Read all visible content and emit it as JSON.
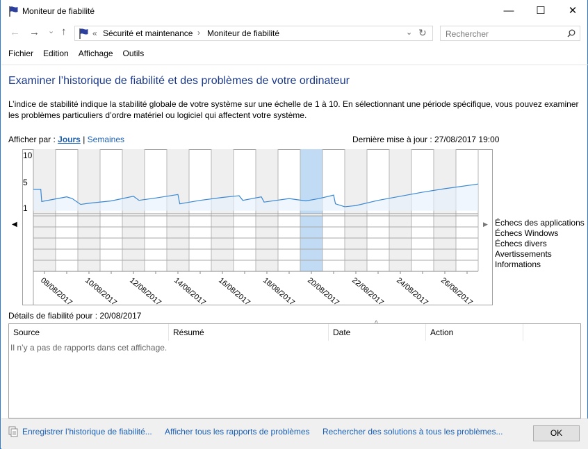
{
  "window": {
    "title": "Moniteur de fiabilité",
    "minimize": "—",
    "maximize": "☐",
    "close": "✕"
  },
  "nav": {
    "back": "←",
    "forward": "→",
    "recent": "⌄",
    "up": "↑",
    "breadcrumb_prefix": "«",
    "breadcrumb": [
      "Sécurité et maintenance",
      "Moniteur de fiabilité"
    ],
    "separator": "›",
    "refresh": "↻",
    "dropdown": "⌄",
    "search_placeholder": "Rechercher"
  },
  "menu": [
    "Fichier",
    "Edition",
    "Affichage",
    "Outils"
  ],
  "main": {
    "heading": "Examiner l’historique de fiabilité et des problèmes de votre ordinateur",
    "description": "L’indice de stabilité indique la stabilité globale de votre système sur une échelle de 1 à 10. En sélectionnant une période spécifique, vous pouvez examiner les problèmes particuliers d’ordre matériel ou logiciel qui affectent votre système.",
    "view_by_label": "Afficher par :",
    "view_days": "Jours",
    "view_sep": "|",
    "view_weeks": "Semaines",
    "last_update": "Dernière mise à jour : 27/08/2017 19:00",
    "details_label": "Détails de fiabilité pour : 20/08/2017",
    "table": {
      "columns": [
        "Source",
        "Résumé",
        "Date",
        "Action"
      ],
      "sorted_column": "Date",
      "empty_message": "Il n’y a pas de rapports dans cet affichage."
    }
  },
  "chart_data": {
    "type": "line",
    "y_ticks": [
      "10",
      "5",
      "1"
    ],
    "ylim": [
      0,
      10
    ],
    "dates": [
      "08/08/2017",
      "09/08/2017",
      "10/08/2017",
      "11/08/2017",
      "12/08/2017",
      "13/08/2017",
      "14/08/2017",
      "15/08/2017",
      "16/08/2017",
      "17/08/2017",
      "18/08/2017",
      "19/08/2017",
      "20/08/2017",
      "21/08/2017",
      "22/08/2017",
      "23/08/2017",
      "24/08/2017",
      "25/08/2017",
      "26/08/2017",
      "27/08/2017"
    ],
    "tick_labels": [
      "08/08/2017",
      "10/08/2017",
      "12/08/2017",
      "14/08/2017",
      "16/08/2017",
      "18/08/2017",
      "20/08/2017",
      "22/08/2017",
      "24/08/2017",
      "26/08/2017"
    ],
    "selected_date": "20/08/2017",
    "series": [
      {
        "points": [
          [
            "08/08/2017 00:00",
            4.2
          ],
          [
            "08/08/2017 08:00",
            4.2
          ],
          [
            "08/08/2017 09:00",
            2.1
          ],
          [
            "09/08/2017 12:00",
            2.9
          ],
          [
            "09/08/2017 18:00",
            2.6
          ],
          [
            "10/08/2017 03:00",
            1.6
          ],
          [
            "10/08/2017 12:00",
            1.8
          ],
          [
            "11/08/2017 12:00",
            2.2
          ],
          [
            "12/08/2017 12:00",
            3.0
          ],
          [
            "12/08/2017 18:00",
            2.3
          ],
          [
            "13/08/2017 12:00",
            2.7
          ],
          [
            "14/08/2017 12:00",
            3.3
          ],
          [
            "14/08/2017 14:00",
            1.7
          ],
          [
            "15/08/2017 12:00",
            2.3
          ],
          [
            "16/08/2017 12:00",
            2.8
          ],
          [
            "17/08/2017 06:00",
            3.1
          ],
          [
            "17/08/2017 10:00",
            2.3
          ],
          [
            "18/08/2017 06:00",
            2.9
          ],
          [
            "18/08/2017 09:00",
            2.0
          ],
          [
            "19/08/2017 12:00",
            2.6
          ],
          [
            "20/08/2017 06:00",
            2.2
          ],
          [
            "20/08/2017 20:00",
            2.6
          ],
          [
            "21/08/2017 12:00",
            3.2
          ],
          [
            "21/08/2017 14:00",
            1.7
          ],
          [
            "22/08/2017 00:00",
            1.2
          ],
          [
            "22/08/2017 12:00",
            1.4
          ],
          [
            "23/08/2017 12:00",
            2.3
          ],
          [
            "24/08/2017 12:00",
            3.0
          ],
          [
            "25/08/2017 12:00",
            3.7
          ],
          [
            "26/08/2017 12:00",
            4.3
          ],
          [
            "27/08/2017 23:59",
            5.1
          ]
        ]
      }
    ],
    "event_rows": [
      "Échecs des applications",
      "Échecs Windows",
      "Échecs divers",
      "Avertissements",
      "Informations"
    ],
    "colors": {
      "line": "#3a87d1",
      "selected": "#c0dbf3",
      "weekend": "#efefef"
    }
  },
  "footer": {
    "save_history": "Enregistrer l’historique de fiabilité...",
    "view_reports": "Afficher tous les rapports de problèmes",
    "check_solutions": "Rechercher des solutions à tous les problèmes...",
    "ok": "OK"
  }
}
